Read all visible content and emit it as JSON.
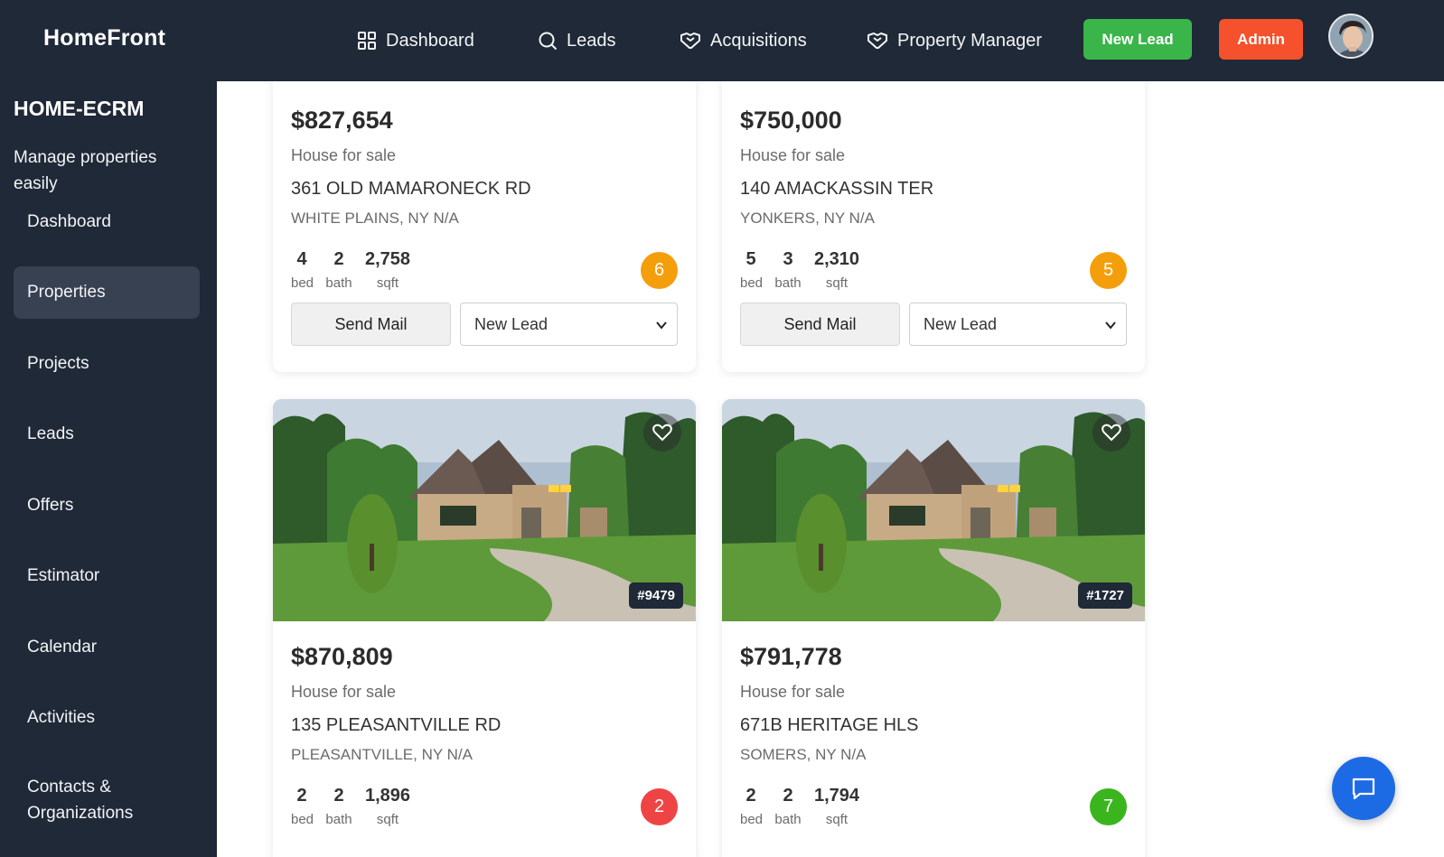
{
  "app": {
    "brand": "HomeFront"
  },
  "topnav": {
    "links": [
      {
        "label": "Dashboard",
        "icon": "grid-icon"
      },
      {
        "label": "Leads",
        "icon": "search-icon"
      },
      {
        "label": "Acquisitions",
        "icon": "handshake-icon"
      },
      {
        "label": "Property Manager",
        "icon": "handshake-icon"
      }
    ],
    "new_lead_label": "New Lead",
    "admin_label": "Admin",
    "colors": {
      "bar": "#1f2937",
      "new_lead": "#3ab54a",
      "admin": "#f4512c"
    }
  },
  "sidebar": {
    "title": "HOME-ECRM",
    "subtitle": "Manage properties easily",
    "items": [
      {
        "label": "Dashboard",
        "active": false
      },
      {
        "label": "Properties",
        "active": true
      },
      {
        "label": "Projects",
        "active": false
      },
      {
        "label": "Leads",
        "active": false
      },
      {
        "label": "Offers",
        "active": false
      },
      {
        "label": "Estimator",
        "active": false
      },
      {
        "label": "Calendar",
        "active": false
      },
      {
        "label": "Activities",
        "active": false
      },
      {
        "label": "Contacts & Organizations",
        "active": false
      }
    ]
  },
  "cards": [
    {
      "price": "$827,654",
      "type": "House for sale",
      "address": "361 OLD MAMARONECK RD",
      "city": "WHITE PLAINS, NY N/A",
      "beds": "4",
      "baths": "2",
      "sqft": "2,758",
      "bed_label": "bed",
      "bath_label": "bath",
      "sqft_label": "sqft",
      "score": "6",
      "score_color": "#f59e0b",
      "mail_label": "Send Mail",
      "status": "New Lead"
    },
    {
      "price": "$750,000",
      "type": "House for sale",
      "address": "140 AMACKASSIN TER",
      "city": "YONKERS, NY N/A",
      "beds": "5",
      "baths": "3",
      "sqft": "2,310",
      "bed_label": "bed",
      "bath_label": "bath",
      "sqft_label": "sqft",
      "score": "5",
      "score_color": "#f59e0b",
      "mail_label": "Send Mail",
      "status": "New Lead"
    },
    {
      "id_tag": "#9479",
      "price": "$870,809",
      "type": "House for sale",
      "address": "135 PLEASANTVILLE RD",
      "city": "PLEASANTVILLE, NY N/A",
      "beds": "2",
      "baths": "2",
      "sqft": "1,896",
      "bed_label": "bed",
      "bath_label": "bath",
      "sqft_label": "sqft",
      "score": "2",
      "score_color": "#ef4444"
    },
    {
      "id_tag": "#1727",
      "price": "$791,778",
      "type": "House for sale",
      "address": "671B HERITAGE HLS",
      "city": "SOMERS, NY N/A",
      "beds": "2",
      "baths": "2",
      "sqft": "1,794",
      "bed_label": "bed",
      "bath_label": "bath",
      "sqft_label": "sqft",
      "score": "7",
      "score_color": "#3ab51e"
    }
  ]
}
